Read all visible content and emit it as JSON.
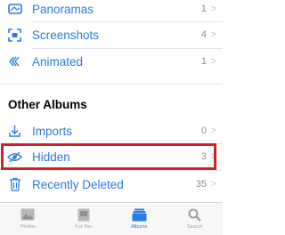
{
  "colors": {
    "accent": "#2a7ae2",
    "highlight": "#d0202a",
    "count_gray": "#8e8e93"
  },
  "media_types": [
    {
      "label": "Panoramas",
      "count": "1",
      "icon": "panorama-icon"
    },
    {
      "label": "Screenshots",
      "count": "4",
      "icon": "screenshot-icon"
    },
    {
      "label": "Animated",
      "count": "1",
      "icon": "animated-icon"
    }
  ],
  "other_albums": {
    "title": "Other Albums",
    "items": [
      {
        "label": "Imports",
        "count": "0",
        "icon": "import-icon"
      },
      {
        "label": "Hidden",
        "count": "3",
        "icon": "eye-slash-icon",
        "highlighted": true
      },
      {
        "label": "Recently Deleted",
        "count": "35",
        "icon": "trash-icon"
      }
    ]
  },
  "tab_bar": {
    "tabs": [
      {
        "label": "Photos",
        "icon": "photos-icon"
      },
      {
        "label": "For You",
        "icon": "for-you-icon"
      },
      {
        "label": "Albums",
        "icon": "albums-icon",
        "active": true
      },
      {
        "label": "Search",
        "icon": "search-icon"
      }
    ]
  },
  "chevron": ">"
}
